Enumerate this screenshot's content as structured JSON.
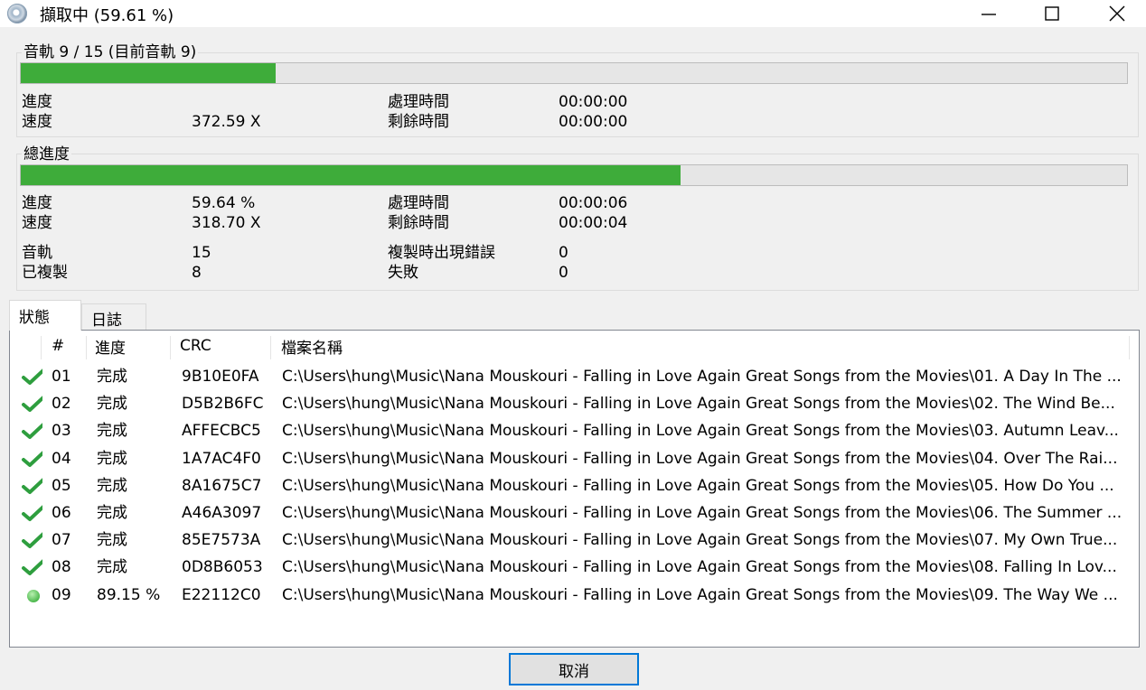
{
  "window": {
    "title": "擷取中 (59.61 %)",
    "icon": "cd-disc-icon",
    "controls": [
      "minimize-icon",
      "maximize-icon",
      "close-icon"
    ]
  },
  "track_group": {
    "label": "音軌 9 / 15 (目前音軌 9)",
    "progress_fraction": 0.23,
    "progress_label": "進度",
    "progress_value": "",
    "speed_label": "速度",
    "speed_value": "372.59 X",
    "elapsed_label": "處理時間",
    "elapsed_value": "00:00:00",
    "remaining_label": "剩餘時間",
    "remaining_value": "00:00:00"
  },
  "total_group": {
    "label": "總進度",
    "progress_fraction": 0.5964,
    "progress_label": "進度",
    "progress_value": "59.64 %",
    "speed_label": "速度",
    "speed_value": "318.70 X",
    "elapsed_label": "處理時間",
    "elapsed_value": "00:00:06",
    "remaining_label": "剩餘時間",
    "remaining_value": "00:00:04",
    "tracks_label": "音軌",
    "tracks_value": "15",
    "copied_label": "已複製",
    "copied_value": "8",
    "errors_label": "複製時出現錯誤",
    "errors_value": "0",
    "failed_label": "失敗",
    "failed_value": "0"
  },
  "tabs": [
    {
      "label": "狀態",
      "active": true
    },
    {
      "label": "日誌",
      "active": false
    }
  ],
  "list": {
    "columns": [
      "",
      "#",
      "進度",
      "CRC",
      "檔案名稱"
    ],
    "rows": [
      {
        "status": "done",
        "num": "01",
        "progress": "完成",
        "crc": "9B10E0FA",
        "file": "C:\\Users\\hung\\Music\\Nana Mouskouri - Falling in Love Again Great Songs from the Movies\\01. A Day In The ..."
      },
      {
        "status": "done",
        "num": "02",
        "progress": "完成",
        "crc": "D5B2B6FC",
        "file": "C:\\Users\\hung\\Music\\Nana Mouskouri - Falling in Love Again Great Songs from the Movies\\02. The Wind Be..."
      },
      {
        "status": "done",
        "num": "03",
        "progress": "完成",
        "crc": "AFFECBC5",
        "file": "C:\\Users\\hung\\Music\\Nana Mouskouri - Falling in Love Again Great Songs from the Movies\\03. Autumn Leav..."
      },
      {
        "status": "done",
        "num": "04",
        "progress": "完成",
        "crc": "1A7AC4F0",
        "file": "C:\\Users\\hung\\Music\\Nana Mouskouri - Falling in Love Again Great Songs from the Movies\\04. Over The Rai..."
      },
      {
        "status": "done",
        "num": "05",
        "progress": "完成",
        "crc": "8A1675C7",
        "file": "C:\\Users\\hung\\Music\\Nana Mouskouri - Falling in Love Again Great Songs from the Movies\\05. How Do You ..."
      },
      {
        "status": "done",
        "num": "06",
        "progress": "完成",
        "crc": "A46A3097",
        "file": "C:\\Users\\hung\\Music\\Nana Mouskouri - Falling in Love Again Great Songs from the Movies\\06. The Summer ..."
      },
      {
        "status": "done",
        "num": "07",
        "progress": "完成",
        "crc": "85E7573A",
        "file": "C:\\Users\\hung\\Music\\Nana Mouskouri - Falling in Love Again Great Songs from the Movies\\07. My Own True..."
      },
      {
        "status": "done",
        "num": "08",
        "progress": "完成",
        "crc": "0D8B6053",
        "file": "C:\\Users\\hung\\Music\\Nana Mouskouri - Falling in Love Again Great Songs from the Movies\\08. Falling In Lov..."
      },
      {
        "status": "in-progress",
        "num": "09",
        "progress": "89.15 %",
        "crc": "E22112C0",
        "file": "C:\\Users\\hung\\Music\\Nana Mouskouri - Falling in Love Again Great Songs from the Movies\\09. The Way We ..."
      }
    ]
  },
  "cancel_label": "取消",
  "colors": {
    "progress_fill": "#3eac3a",
    "check": "#2e9e3e",
    "dot": "#49b64a",
    "focus_border": "#0078d7"
  }
}
